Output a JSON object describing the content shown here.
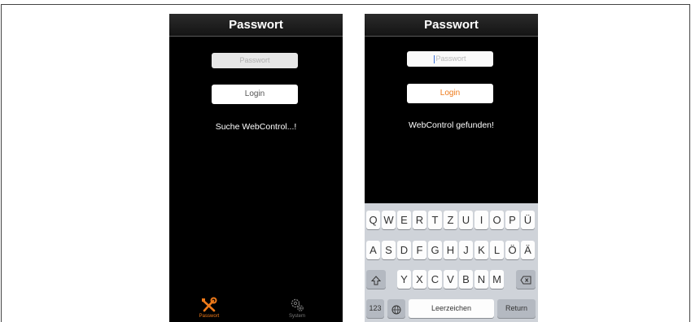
{
  "left_screen": {
    "title": "Passwort",
    "password_placeholder": "Passwort",
    "login_label": "Login",
    "status": "Suche WebControl...!",
    "tabs": [
      {
        "label": "Passwort",
        "icon": "tools-icon",
        "active": true
      },
      {
        "label": "System",
        "icon": "gears-icon",
        "active": false
      }
    ]
  },
  "right_screen": {
    "title": "Passwort",
    "password_placeholder": "Passwort",
    "login_label": "Login",
    "status": "WebControl gefunden!",
    "keyboard": {
      "row1": [
        "Q",
        "W",
        "E",
        "R",
        "T",
        "Z",
        "U",
        "I",
        "O",
        "P",
        "Ü"
      ],
      "row2": [
        "A",
        "S",
        "D",
        "F",
        "G",
        "H",
        "J",
        "K",
        "L",
        "Ö",
        "Ä"
      ],
      "row3": [
        "Y",
        "X",
        "C",
        "V",
        "B",
        "N",
        "M"
      ],
      "numbers_label": "123",
      "space_label": "Leerzeichen",
      "return_label": "Return"
    }
  },
  "colors": {
    "accent": "#ee7a1a",
    "screen_bg": "#000000",
    "keyboard_bg": "#cfd3d9"
  }
}
